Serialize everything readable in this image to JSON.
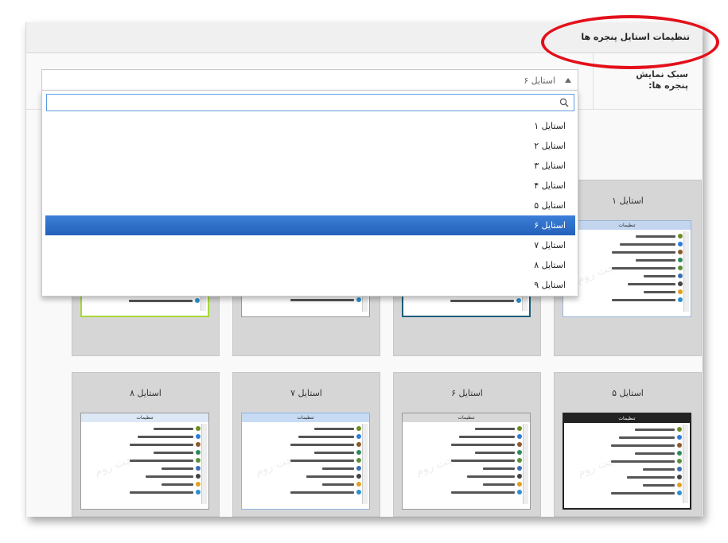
{
  "panel": {
    "title": "تنظیمات استایل پنجره ها"
  },
  "setting": {
    "label": "سبک نمایش پنجره ها:"
  },
  "select": {
    "value": "استایل ۶",
    "search_placeholder": ""
  },
  "dropdown": {
    "options": [
      "استایل ۱",
      "استایل ۲",
      "استایل ۳",
      "استایل ۴",
      "استایل ۵",
      "استایل ۶",
      "استایل ۷",
      "استایل ۸",
      "استایل ۹"
    ],
    "selected_index": 5
  },
  "cards": [
    {
      "label": "استایل ۱",
      "frame": "#c4d6ef",
      "title": "تنظیمات"
    },
    {
      "label": "",
      "frame": "#1e5d7a",
      "title": ""
    },
    {
      "label": "",
      "frame": "#cfcfcf",
      "title": ""
    },
    {
      "label": "",
      "frame": "#a8d83a",
      "title": ""
    },
    {
      "label": "استایل ۵",
      "frame": "#222222",
      "title": "تنظیمات"
    },
    {
      "label": "استایل ۶",
      "frame": "#d8d8d8",
      "title": "تنظیمات"
    },
    {
      "label": "استایل ۷",
      "frame": "#c7dcf4",
      "title": "تنظیمات"
    },
    {
      "label": "استایل ۸",
      "frame": "#dde8f7",
      "title": "تنظیمات"
    }
  ],
  "thumb_items": [
    "ساخت چت گروهی درخصوصی (کنفرانس)",
    "پاک کردن پیام های عمومی",
    "تغییر اولاتر پیشفرض",
    "حذف و آزاد سازی نام کاربری",
    "لیست دوستان من",
    "درخواست های دوستانی تایید نشده",
    "لیست مسدود شده ها",
    "تاریخچه چت",
    "تغییر رمز"
  ],
  "accent_colors": {
    "highlight": "#2c6ac6",
    "annotation": "#e3101a"
  }
}
